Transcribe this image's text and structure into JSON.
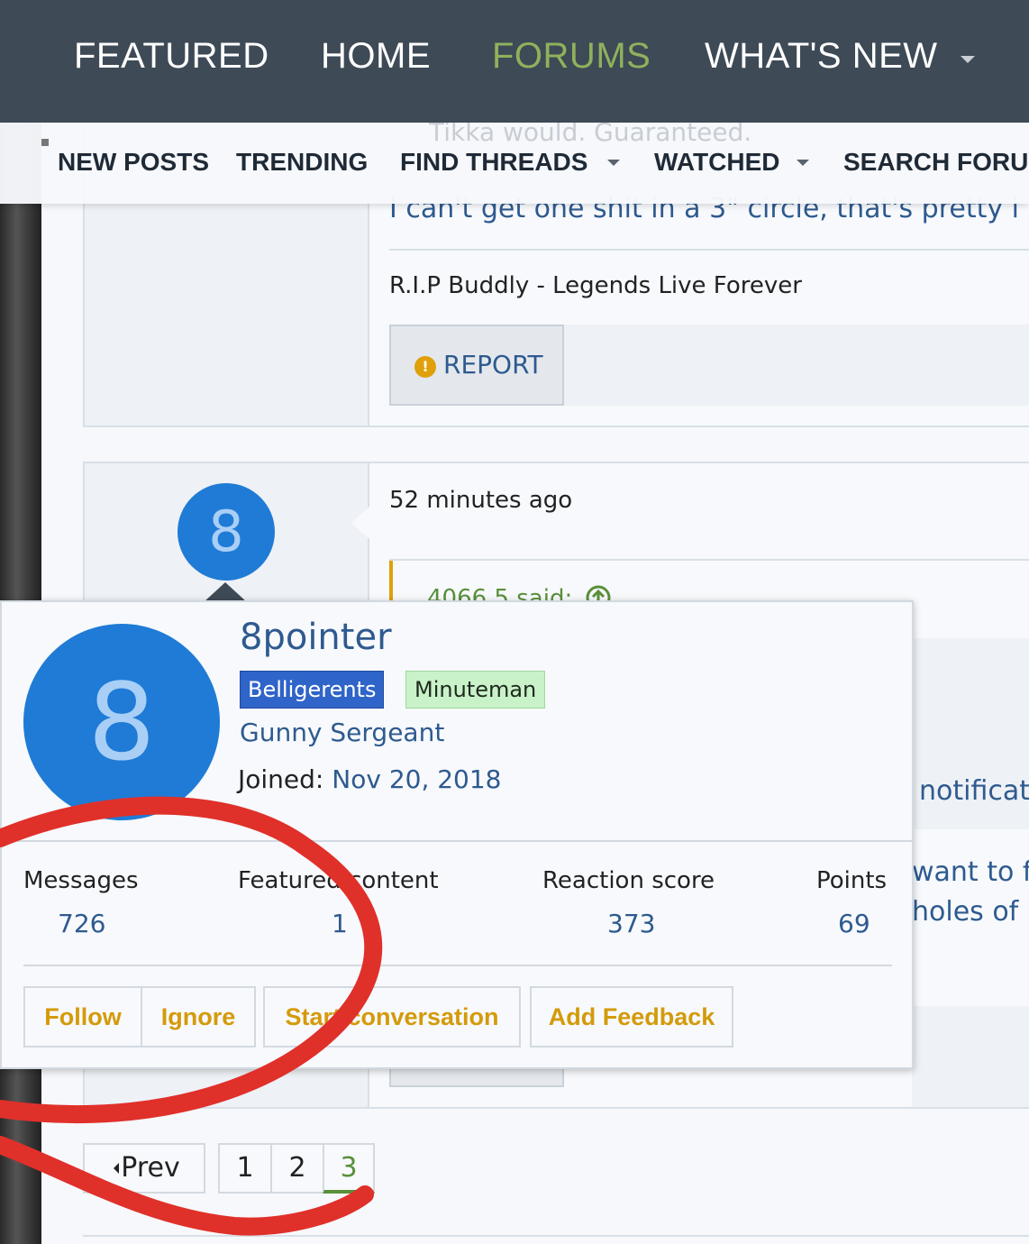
{
  "top_nav": {
    "tabs": [
      {
        "label": "FEATURED"
      },
      {
        "label": "HOME"
      },
      {
        "label": "FORUMS"
      },
      {
        "label": "WHAT'S NEW"
      }
    ]
  },
  "sub_nav": {
    "behind_text": "Tikka would. Guaranteed.",
    "items": [
      {
        "label": "NEW POSTS"
      },
      {
        "label": "TRENDING"
      },
      {
        "label": "FIND THREADS"
      },
      {
        "label": "WATCHED"
      },
      {
        "label": "SEARCH FORUN"
      }
    ]
  },
  "post1": {
    "quote_text": "I can't get one shit in a 3\" circle, that's pretty i",
    "signature": "R.I.P Buddly - Legends Live Forever",
    "report_label": "REPORT",
    "report_icon": "!"
  },
  "post2": {
    "avatar_letter": "8",
    "time": "52 minutes ago",
    "quote_said": "4066.5 said:",
    "right_fragments": [
      "notificat",
      "want to f",
      "holes of"
    ]
  },
  "member_card": {
    "avatar_letter": "8",
    "username": "8pointer",
    "badges": [
      "Belligerents",
      "Minuteman"
    ],
    "rank": "Gunny Sergeant",
    "joined_label": "Joined:",
    "joined_date": "Nov 20, 2018",
    "stats": [
      {
        "label": "Messages",
        "value": "726"
      },
      {
        "label": "Featured content",
        "value": "1"
      },
      {
        "label": "Reaction score",
        "value": "373"
      },
      {
        "label": "Points",
        "value": "69"
      }
    ],
    "buttons": [
      "Follow",
      "Ignore",
      "Start conversation",
      "Add Feedback"
    ]
  },
  "pagination": {
    "prev_label": "Prev",
    "pages": [
      "1",
      "2",
      "3"
    ],
    "current": "3"
  },
  "colors": {
    "nav_bg": "#3e4a56",
    "active_tab": "#8fb15c",
    "link_blue": "#2e5a8f",
    "button_gold": "#d49a0a",
    "annotation_red": "#e0302a"
  }
}
